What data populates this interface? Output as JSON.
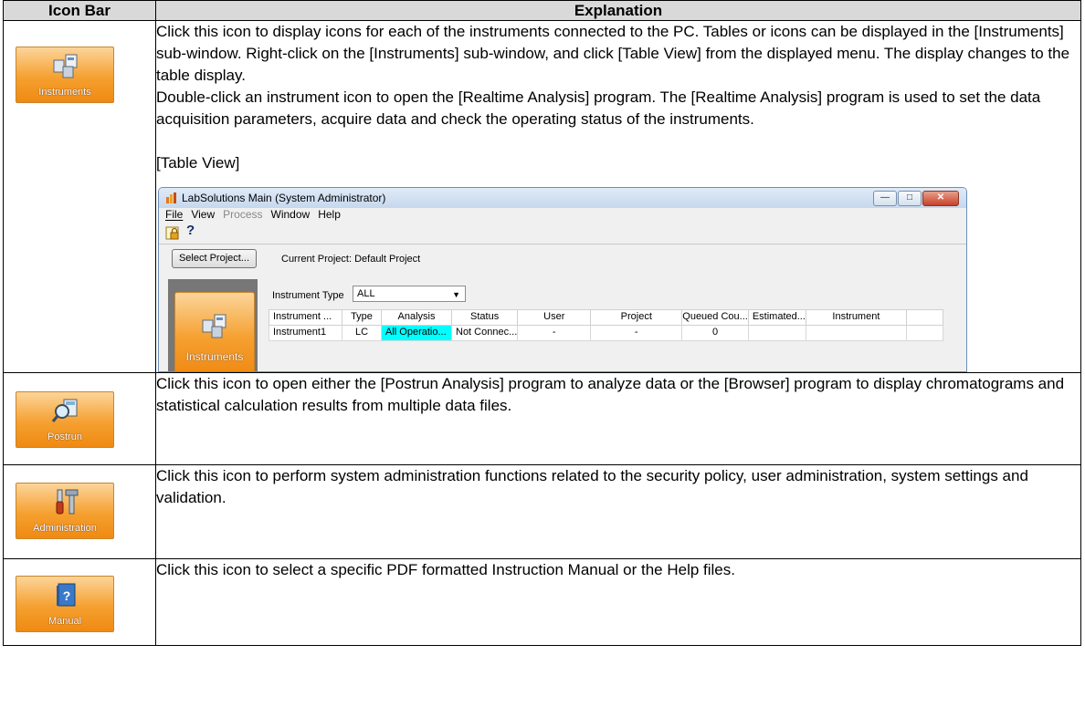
{
  "table": {
    "headers": {
      "icon_bar": "Icon Bar",
      "explanation": "Explanation"
    }
  },
  "rows": [
    {
      "icon_label": "Instruments",
      "paragraphs": [
        "Click this icon to display icons for each of the instruments connected to the PC. Tables or icons can be displayed in the [Instruments] sub-window. Right-click on the [Instruments] sub-window, and click [Table View] from the displayed menu. The display changes to the table display.",
        "Double-click an instrument icon to open the [Realtime Analysis] program. The [Realtime Analysis] program is used to set the data acquisition parameters, acquire data and check the operating status of the instruments."
      ],
      "subheading": "[Table View]"
    },
    {
      "icon_label": "Postrun",
      "paragraphs": [
        "Click this icon to open either the [Postrun Analysis] program to analyze data or the [Browser] program to display chromatograms and statistical calculation results from multiple data files."
      ]
    },
    {
      "icon_label": "Administration",
      "paragraphs": [
        "Click this icon to perform system administration functions related to the security policy, user administration, system settings and validation."
      ]
    },
    {
      "icon_label": "Manual",
      "paragraphs": [
        "Click this icon  to select a specific PDF formatted Instruction Manual or the Help files."
      ]
    }
  ],
  "screenshot": {
    "title": "LabSolutions Main (System Administrator)",
    "menu": [
      "File",
      "View",
      "Process",
      "Window",
      "Help"
    ],
    "help_glyph": "?",
    "select_project_label": "Select Project...",
    "current_project": "Current Project: Default Project",
    "panel_icon_label": "Instruments",
    "instrument_type_label": "Instrument Type",
    "instrument_type_value": "ALL",
    "grid_headers": [
      "Instrument ...",
      "Type",
      "Analysis",
      "Status",
      "User",
      "Project",
      "Queued Cou...",
      "Estimated...",
      "Instrument"
    ],
    "grid_rows": [
      [
        "Instrument1",
        "LC",
        "All Operatio...",
        "Not Connec...",
        "-",
        "-",
        "0",
        "",
        ""
      ]
    ]
  },
  "colors": {
    "header_bg": "#d9d9d9",
    "icon_orange": "#f5a030",
    "highlight_cyan": "#00ffff"
  }
}
